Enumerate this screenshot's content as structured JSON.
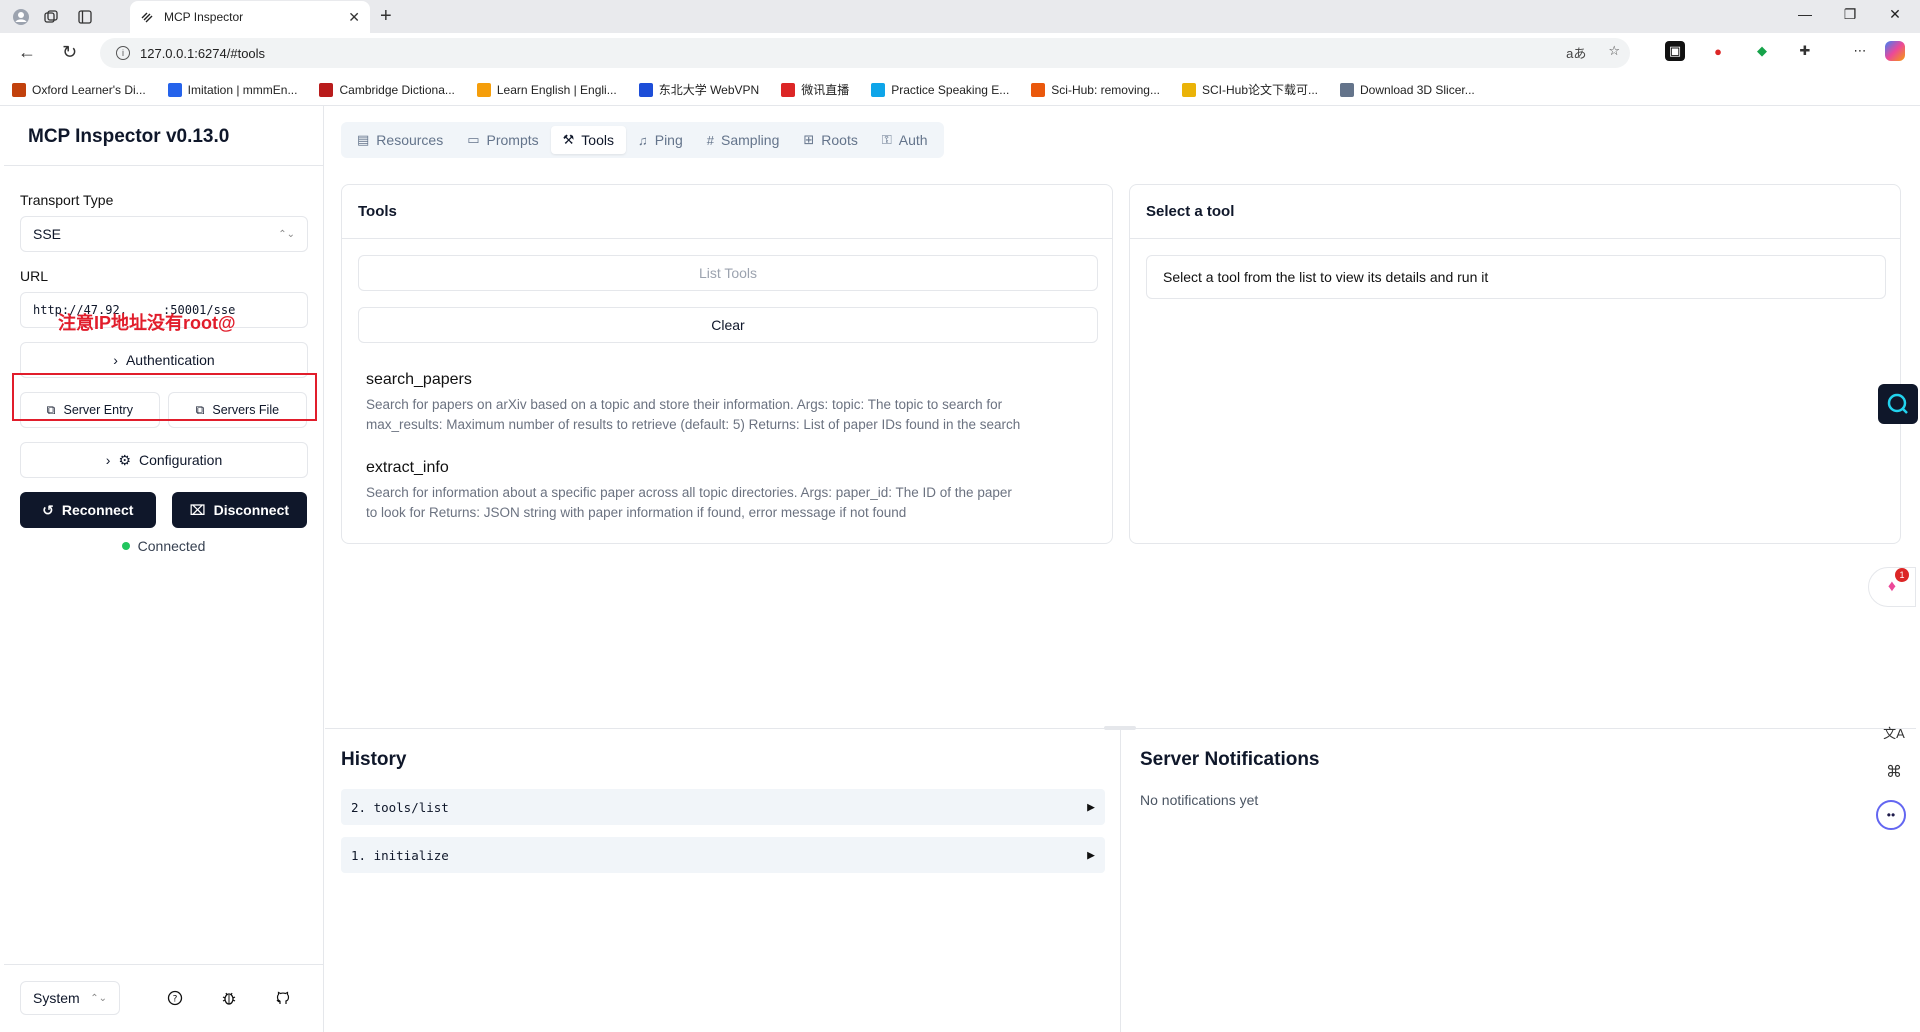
{
  "browser": {
    "tab_title": "MCP Inspector",
    "url": "127.0.0.1:6274/#tools",
    "bookmarks": [
      {
        "label": "Oxford Learner's Di...",
        "color": "#c2410c"
      },
      {
        "label": "Imitation | mmmEn...",
        "color": "#2563eb"
      },
      {
        "label": "Cambridge Dictiona...",
        "color": "#b91c1c"
      },
      {
        "label": "Learn English | Engli...",
        "color": "#f59e0b"
      },
      {
        "label": "东北大学 WebVPN",
        "color": "#1d4ed8"
      },
      {
        "label": "微讯直播",
        "color": "#dc2626"
      },
      {
        "label": "Practice Speaking E...",
        "color": "#0ea5e9"
      },
      {
        "label": "Sci-Hub: removing...",
        "color": "#ea580c"
      },
      {
        "label": "SCI-Hub论文下载可...",
        "color": "#eab308"
      },
      {
        "label": "Download 3D Slicer...",
        "color": "#64748b"
      }
    ]
  },
  "sidebar": {
    "title": "MCP Inspector v0.13.0",
    "transport_label": "Transport Type",
    "transport_value": "SSE",
    "url_label": "URL",
    "url_value": "http://47.92.     :50001/sse",
    "annotation": "注意IP地址没有root@",
    "authentication": "Authentication",
    "server_entry": "Server Entry",
    "servers_file": "Servers File",
    "configuration": "Configuration",
    "reconnect": "Reconnect",
    "disconnect": "Disconnect",
    "status": "Connected",
    "theme": "System"
  },
  "tabs": [
    "Resources",
    "Prompts",
    "Tools",
    "Ping",
    "Sampling",
    "Roots",
    "Auth"
  ],
  "active_tab": "Tools",
  "tools_panel": {
    "title": "Tools",
    "list_button": "List Tools",
    "clear_button": "Clear",
    "items": [
      {
        "name": "search_papers",
        "line1": "Search for papers on arXiv based on a topic and store their information. Args: topic: The topic to search for",
        "line2": "max_results: Maximum number of results to retrieve (default: 5) Returns: List of paper IDs found in the search"
      },
      {
        "name": "extract_info",
        "line1": "Search for information about a specific paper across all topic directories. Args: paper_id: The ID of the paper",
        "line2": "to look for Returns: JSON string with paper information if found, error message if not found"
      }
    ]
  },
  "detail_panel": {
    "title": "Select a tool",
    "hint": "Select a tool from the list to view its details and run it"
  },
  "history": {
    "title": "History",
    "items": [
      "2. tools/list",
      "1. initialize"
    ]
  },
  "notifications": {
    "title": "Server Notifications",
    "empty": "No notifications yet"
  },
  "badge_count": "1"
}
